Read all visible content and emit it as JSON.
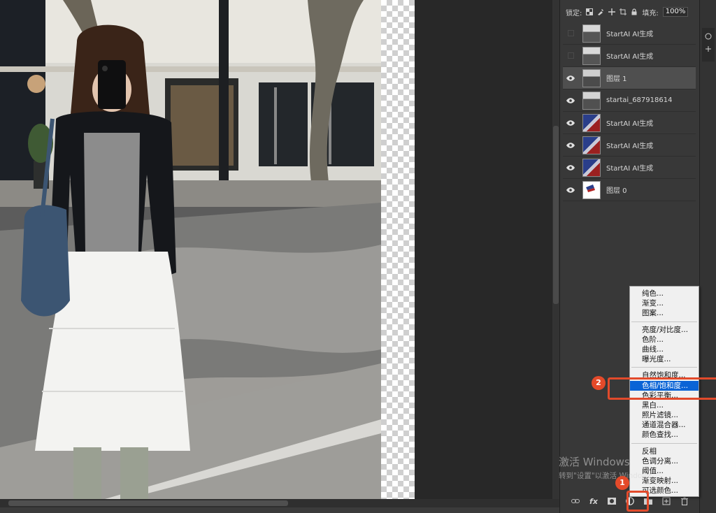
{
  "toolbar": {
    "lock_label": "锁定:",
    "fill_label": "填充:",
    "fill_value": "100%"
  },
  "layers": [
    {
      "name": "StartAI AI生成",
      "visible": false,
      "selected": false,
      "thumb": "photo-bw"
    },
    {
      "name": "StartAI AI生成",
      "visible": false,
      "selected": false,
      "thumb": "photo-bw"
    },
    {
      "name": "图层 1",
      "visible": true,
      "selected": true,
      "thumb": "photo-bw"
    },
    {
      "name": "startai_687918614",
      "visible": true,
      "selected": false,
      "thumb": "photo-bw"
    },
    {
      "name": "StartAI AI生成",
      "visible": true,
      "selected": false,
      "thumb": "photo-color"
    },
    {
      "name": "StartAI AI生成",
      "visible": true,
      "selected": false,
      "thumb": "photo-color"
    },
    {
      "name": "StartAI AI生成",
      "visible": true,
      "selected": false,
      "thumb": "photo-color"
    },
    {
      "name": "图层 0",
      "visible": true,
      "selected": false,
      "thumb": "white-flag"
    }
  ],
  "menu": {
    "groups": [
      [
        "纯色...",
        "渐变...",
        "图案..."
      ],
      [
        "亮度/对比度...",
        "色阶...",
        "曲线...",
        "曝光度..."
      ],
      [
        "自然饱和度...",
        "色相/饱和度...",
        "色彩平衡...",
        "黑白...",
        "照片滤镜...",
        "通道混合器...",
        "颜色查找..."
      ],
      [
        "反相",
        "色调分离...",
        "阈值...",
        "渐变映射...",
        "可选颜色..."
      ]
    ],
    "highlighted": "色相/饱和度..."
  },
  "annotations": {
    "badge1": "1",
    "badge2": "2"
  },
  "watermark": {
    "line1": "激活 Windows",
    "line2": "转到\"设置\"以激活 Windows。"
  },
  "colors": {
    "accent": "#0a64d6",
    "annotation": "#e44a2a",
    "panel": "#383838"
  }
}
